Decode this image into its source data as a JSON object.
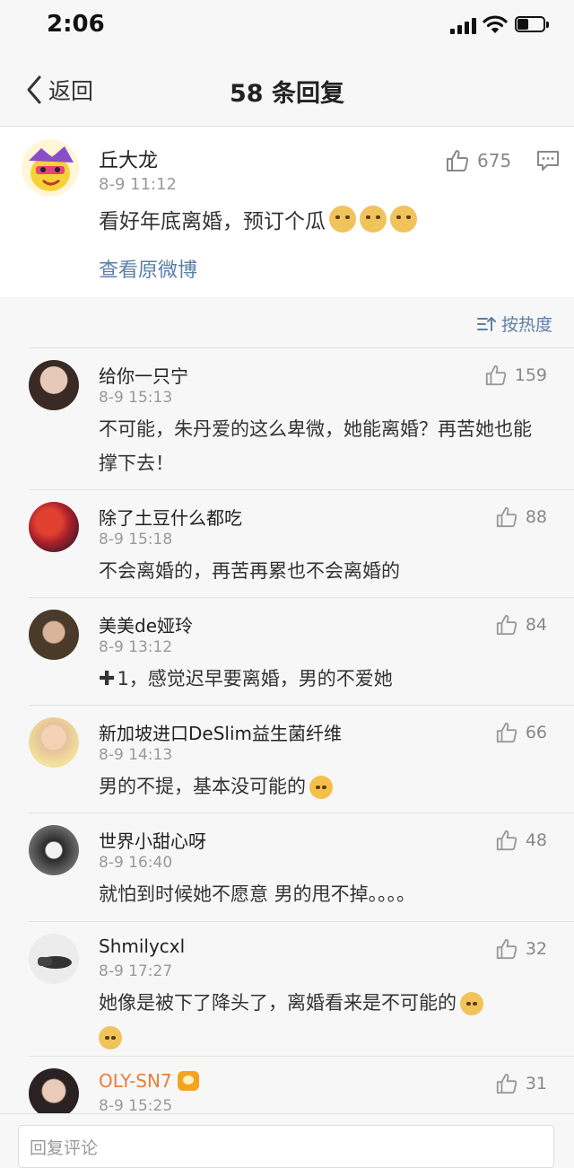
{
  "status_bar": {
    "time": "2:06"
  },
  "nav": {
    "back_label": "返回",
    "title": "58 条回复"
  },
  "post": {
    "author": "丘大龙",
    "time": "8-9 11:12",
    "text": "看好年底离婚，预订个瓜",
    "emoji_count": 3,
    "likes": "675",
    "view_original": "查看原微博"
  },
  "sort": {
    "label": "按热度"
  },
  "comments": [
    {
      "name": "给你一只宁",
      "time": "8-9 15:13",
      "text": "不可能，朱丹爱的这么卑微，她能离婚？再苦她也能撑下去！",
      "likes": "159",
      "avatar_color": "#3a2a25"
    },
    {
      "name": "除了土豆什么都吃",
      "time": "8-9 15:18",
      "text": "不会离婚的，再苦再累也不会离婚的",
      "likes": "88",
      "avatar_color": "#a8202a"
    },
    {
      "name": "美美de娅玲",
      "time": "8-9 13:12",
      "prefix": "✚",
      "text": "1，感觉迟早要离婚，男的不爱她",
      "likes": "84",
      "avatar_color": "#4a3a2a"
    },
    {
      "name": "新加坡进口DeSlim益生菌纤维",
      "time": "8-9 14:13",
      "text": "男的不提，基本没可能的",
      "likes": "66",
      "avatar_color": "#e6c39a"
    },
    {
      "name": "世界小甜心呀",
      "time": "8-9 16:40",
      "text": "就怕到时候她不愿意 男的甩不掉。。。。",
      "likes": "48",
      "avatar_color": "#6b6b6b"
    },
    {
      "name": "Shmilycxl",
      "time": "8-9 17:27",
      "text": "她像是被下了降头了，离婚看来是不可能的",
      "likes": "32",
      "avatar_color": "#e9e9e9"
    },
    {
      "name": "OLY-SN7",
      "time": "8-9 15:25",
      "text": "",
      "likes": "31",
      "avatar_color": "#2a2222",
      "vip": true
    }
  ],
  "reply_input": {
    "placeholder": "回复评论"
  }
}
